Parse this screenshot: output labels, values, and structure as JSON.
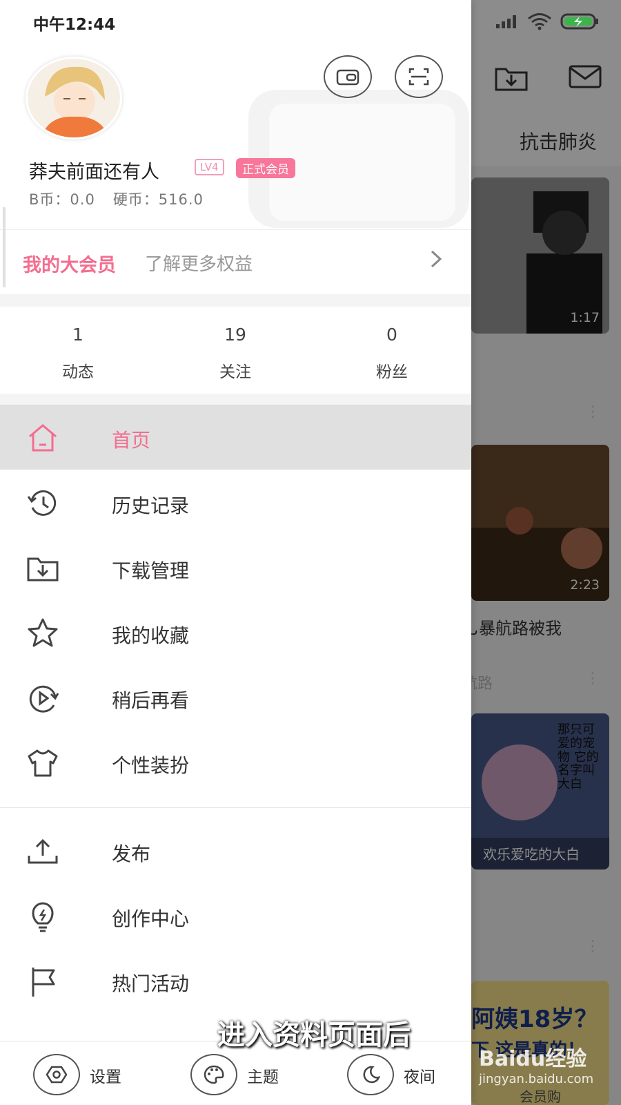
{
  "status_bar": {
    "time": "中午12:44"
  },
  "profile": {
    "username": "莽夫前面还有人",
    "level": "LV4",
    "vip_badge": "正式会员",
    "bcoin": "B币：0.0",
    "coins": "硬币：516.0"
  },
  "vip": {
    "title": "我的大会员",
    "subtitle": "了解更多权益"
  },
  "stats": [
    {
      "num": "1",
      "label": "动态"
    },
    {
      "num": "19",
      "label": "关注"
    },
    {
      "num": "0",
      "label": "粉丝"
    }
  ],
  "menu": [
    {
      "label": "首页",
      "icon": "home-icon",
      "active": true
    },
    {
      "label": "历史记录",
      "icon": "history-icon"
    },
    {
      "label": "下载管理",
      "icon": "download-folder-icon"
    },
    {
      "label": "我的收藏",
      "icon": "star-icon"
    },
    {
      "label": "稍后再看",
      "icon": "watch-later-icon"
    },
    {
      "label": "个性装扮",
      "icon": "tshirt-icon"
    },
    {
      "label": "发布",
      "icon": "upload-icon"
    },
    {
      "label": "创作中心",
      "icon": "lightbulb-icon"
    },
    {
      "label": "热门活动",
      "icon": "flag-icon"
    }
  ],
  "bottom": [
    {
      "label": "设置",
      "icon": "settings-icon"
    },
    {
      "label": "主题",
      "icon": "palette-icon"
    },
    {
      "label": "夜间",
      "icon": "moon-icon"
    }
  ],
  "background": {
    "tab_title": "抗击肺炎",
    "cards": [
      {
        "duration": "1:17"
      },
      {
        "duration": "2:23",
        "title": "乚暴航路被我",
        "sub": "航路"
      },
      {
        "caption": "欢乐爱吃的大白",
        "overlay": "那只可爱的宠物 它的名字叫大白"
      },
      {
        "title": "阿姨18岁？",
        "sub": "下 这是真的！",
        "footer": "会员购"
      }
    ]
  },
  "subtitle": "进入资料页面后",
  "watermark": {
    "brand": "Baidu经验",
    "url": "jingyan.baidu.com"
  }
}
